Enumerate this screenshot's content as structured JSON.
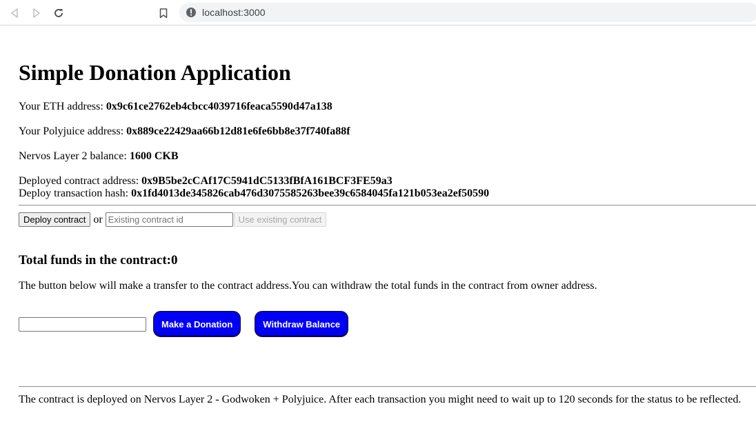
{
  "browser": {
    "url": "localhost:3000",
    "icons": [
      "back-arrow-icon",
      "forward-arrow-icon",
      "reload-icon",
      "bookmark-icon",
      "info-icon"
    ]
  },
  "app": {
    "title": "Simple Donation Application",
    "eth_address_label": "Your ETH address: ",
    "eth_address": "0x9c61ce2762eb4cbcc4039716feaca5590d47a138",
    "polyjuice_address_label": "Your Polyjuice address: ",
    "polyjuice_address": "0x889ce22429aa66b12d81e6fe6bb8e37f740fa88f",
    "balance_label": "Nervos Layer 2 balance: ",
    "balance": "1600 CKB",
    "deployed_contract_label": "Deployed contract address: ",
    "deployed_contract": "0x9B5be2cCAf17C5941dC5133fBfA161BCF3FE59a3",
    "deploy_tx_label": "Deploy transaction hash: ",
    "deploy_tx": "0x1fd4013de345826cab476d3075585263bee39c6584045fa121b053ea2ef50590"
  },
  "deploy": {
    "deploy_button": "Deploy contract",
    "or_text": "or",
    "existing_placeholder": "Existing contract id",
    "existing_value": "",
    "use_existing_button": "Use existing contract"
  },
  "funds": {
    "heading": "Total funds in the contract:0",
    "description": "The button below will make a transfer to the contract address.You can withdraw the total funds in the contract from owner address.",
    "amount_value": "",
    "donate_button": "Make a Donation",
    "withdraw_button": "Withdraw Balance",
    "button_color": "#0000f5"
  },
  "footer": {
    "note": "The contract is deployed on Nervos Layer 2 - Godwoken + Polyjuice. After each transaction you might need to wait up to 120 seconds for the status to be reflected."
  }
}
